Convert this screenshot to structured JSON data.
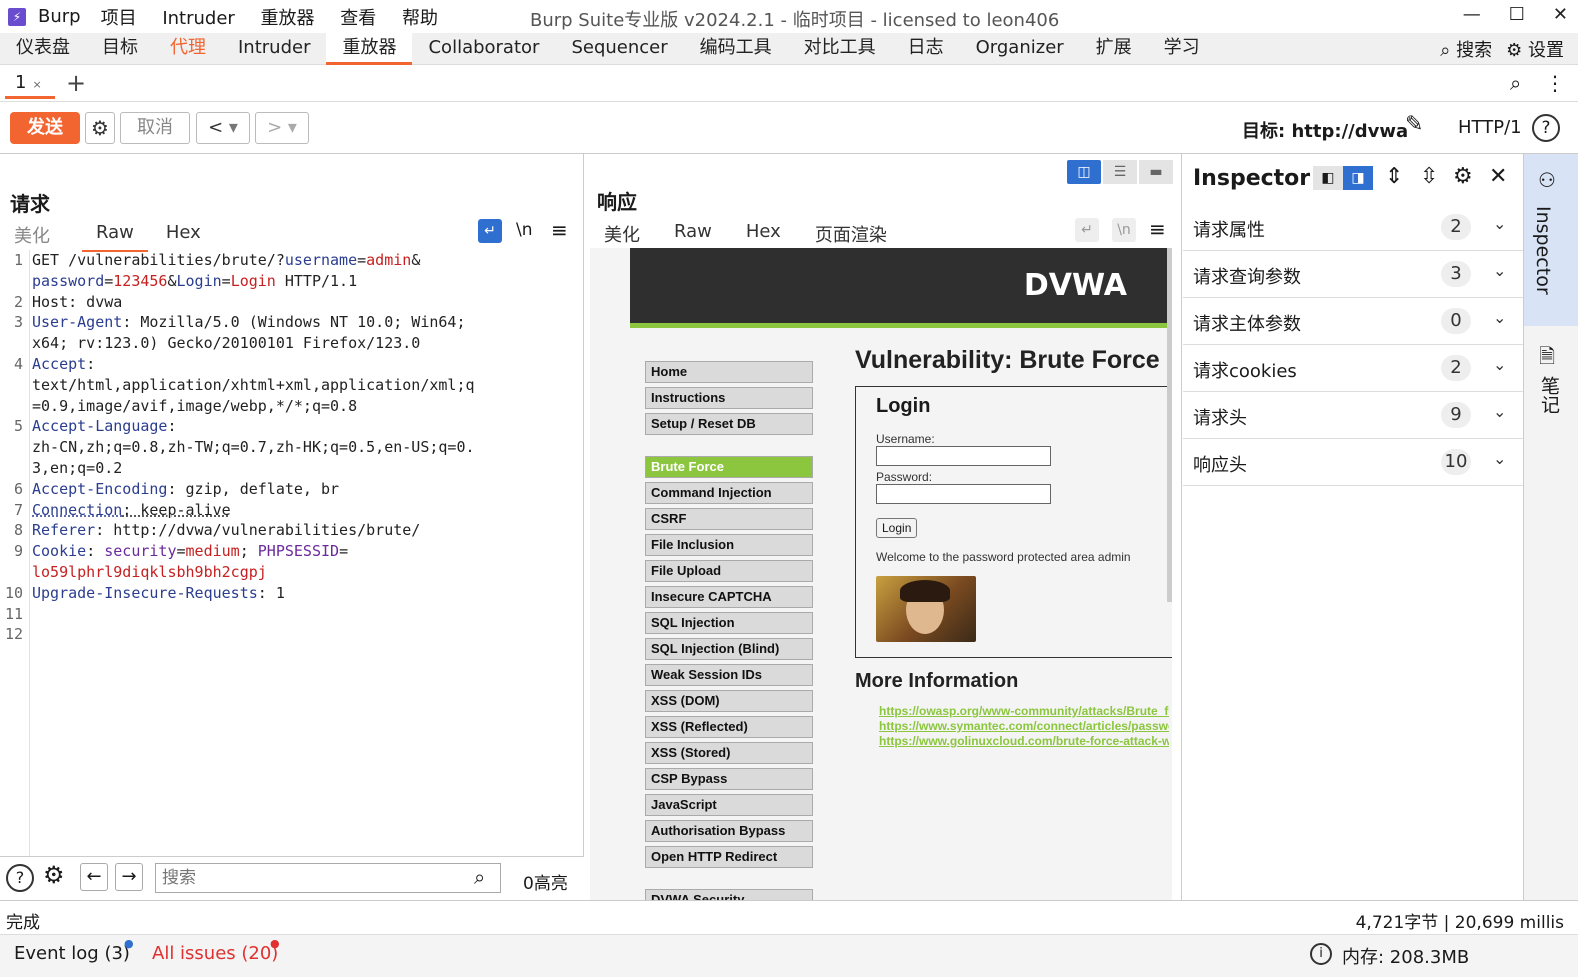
{
  "titlebar": {
    "app": "Burp",
    "menu": [
      "项目",
      "Intruder",
      "重放器",
      "查看",
      "帮助"
    ],
    "title": "Burp Suite专业版  v2024.2.1 - 临时项目 - licensed to leon406"
  },
  "maintabs": [
    "仪表盘",
    "目标",
    "代理",
    "Intruder",
    "重放器",
    "Collaborator",
    "Sequencer",
    "编码工具",
    "对比工具",
    "日志",
    "Organizer",
    "扩展",
    "学习"
  ],
  "maintabs_right": {
    "search": "搜索",
    "settings": "设置"
  },
  "subtab": {
    "label": "1",
    "close": "×",
    "add": "+"
  },
  "toolbar": {
    "send": "发送",
    "cancel": "取消",
    "target": "目标: http://dvwa",
    "http": "HTTP/1"
  },
  "request": {
    "title": "请求",
    "tabs": [
      "美化",
      "Raw",
      "Hex"
    ],
    "newline": "\\n",
    "line_numbers": [
      "1",
      "",
      "2",
      "3",
      "",
      "4",
      "",
      "",
      "5",
      "",
      "",
      "6",
      "7",
      "8",
      "9",
      "",
      "10",
      "11",
      "12"
    ],
    "search_placeholder": "搜索",
    "highlights": "0高亮"
  },
  "response": {
    "title": "响应",
    "tabs": [
      "美化",
      "Raw",
      "Hex",
      "页面渲染"
    ],
    "newline": "\\n"
  },
  "dvwa": {
    "logo": "DVWA",
    "menu": [
      "Home",
      "Instructions",
      "Setup / Reset DB",
      "Brute Force",
      "Command Injection",
      "CSRF",
      "File Inclusion",
      "File Upload",
      "Insecure CAPTCHA",
      "SQL Injection",
      "SQL Injection (Blind)",
      "Weak Session IDs",
      "XSS (DOM)",
      "XSS (Reflected)",
      "XSS (Stored)",
      "CSP Bypass",
      "JavaScript",
      "Authorisation Bypass",
      "Open HTTP Redirect",
      "DVWA Security"
    ],
    "heading": "Vulnerability: Brute Force",
    "login_title": "Login",
    "username_label": "Username:",
    "password_label": "Password:",
    "login_button": "Login",
    "welcome": "Welcome to the password protected area admin",
    "more_info": "More Information",
    "links": [
      "https://owasp.org/www-community/attacks/Brute_force_attack",
      "https://www.symantec.com/connect/articles/password-crackers-ensuring-security-your-password",
      "https://www.golinuxcloud.com/brute-force-attack-web-forms"
    ]
  },
  "inspector": {
    "title": "Inspector",
    "rows": [
      {
        "label": "请求属性",
        "count": "2"
      },
      {
        "label": "请求查询参数",
        "count": "3"
      },
      {
        "label": "请求主体参数",
        "count": "0"
      },
      {
        "label": "请求cookies",
        "count": "2"
      },
      {
        "label": "请求头",
        "count": "9"
      },
      {
        "label": "响应头",
        "count": "10"
      }
    ]
  },
  "sidebar": {
    "inspector": "Inspector",
    "notes": "笔记"
  },
  "status": {
    "left": "完成",
    "right": "4,721字节 | 20,699 millis"
  },
  "bottom": {
    "eventlog": "Event log (3)",
    "issues": "All issues (20)",
    "memory": "内存: 208.3MB"
  },
  "colors": {
    "accent": "#f26531",
    "dvwa_green": "#8cc63f"
  }
}
